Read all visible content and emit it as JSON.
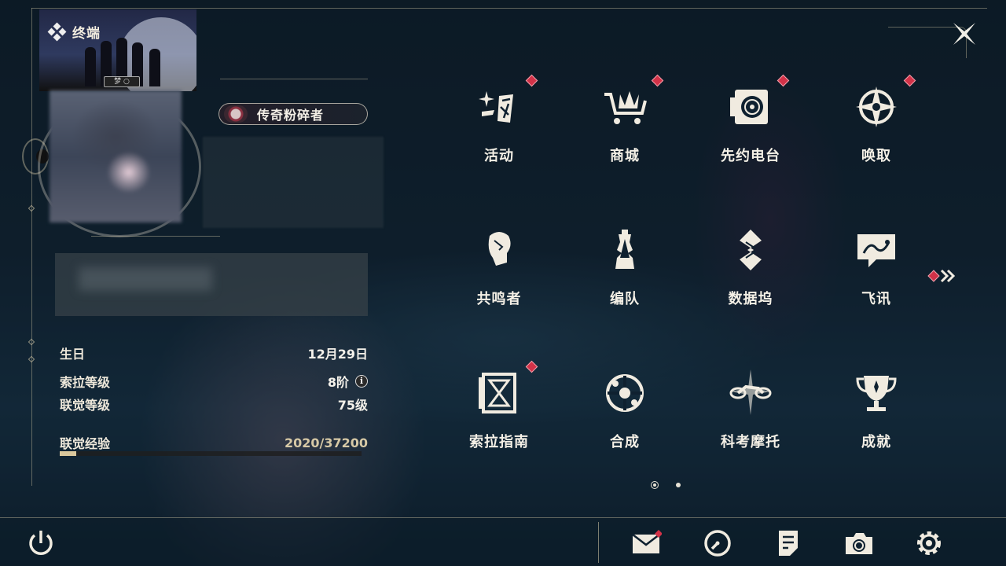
{
  "header": {
    "title": "终端"
  },
  "profile": {
    "card_plate": "梦 ○",
    "title_badge": "传奇粉碎者"
  },
  "stats": [
    {
      "label": "生日",
      "value": "12月29日"
    },
    {
      "label": "索拉等级",
      "value": "8阶"
    },
    {
      "label": "联觉等级",
      "value": "75级"
    }
  ],
  "experience": {
    "label": "联觉经验",
    "value": "2020/37200",
    "current": 2020,
    "max": 37200
  },
  "grid": [
    {
      "label": "活动",
      "icon": "events-icon",
      "badge": true
    },
    {
      "label": "商城",
      "icon": "shop-icon",
      "badge": true
    },
    {
      "label": "先约电台",
      "icon": "radio-icon",
      "badge": true
    },
    {
      "label": "唤取",
      "icon": "convene-icon",
      "badge": true
    },
    {
      "label": "共鸣者",
      "icon": "resonator-icon",
      "badge": false
    },
    {
      "label": "编队",
      "icon": "team-icon",
      "badge": false
    },
    {
      "label": "数据坞",
      "icon": "data-dock-icon",
      "badge": false
    },
    {
      "label": "飞讯",
      "icon": "chat-icon",
      "badge": false
    },
    {
      "label": "索拉指南",
      "icon": "guidebook-icon",
      "badge": true
    },
    {
      "label": "合成",
      "icon": "synthesis-icon",
      "badge": false
    },
    {
      "label": "科考摩托",
      "icon": "motorcycle-icon",
      "badge": false
    },
    {
      "label": "成就",
      "icon": "achievement-icon",
      "badge": false
    }
  ],
  "pagination": {
    "current": 1,
    "total": 2
  },
  "bottom_icons": [
    "power-icon",
    "mail-icon",
    "clock-icon",
    "notes-icon",
    "camera-icon",
    "settings-icon"
  ],
  "colors": {
    "notification": "#d23248",
    "accent": "#d9c79c",
    "text": "#f4f0e6"
  }
}
